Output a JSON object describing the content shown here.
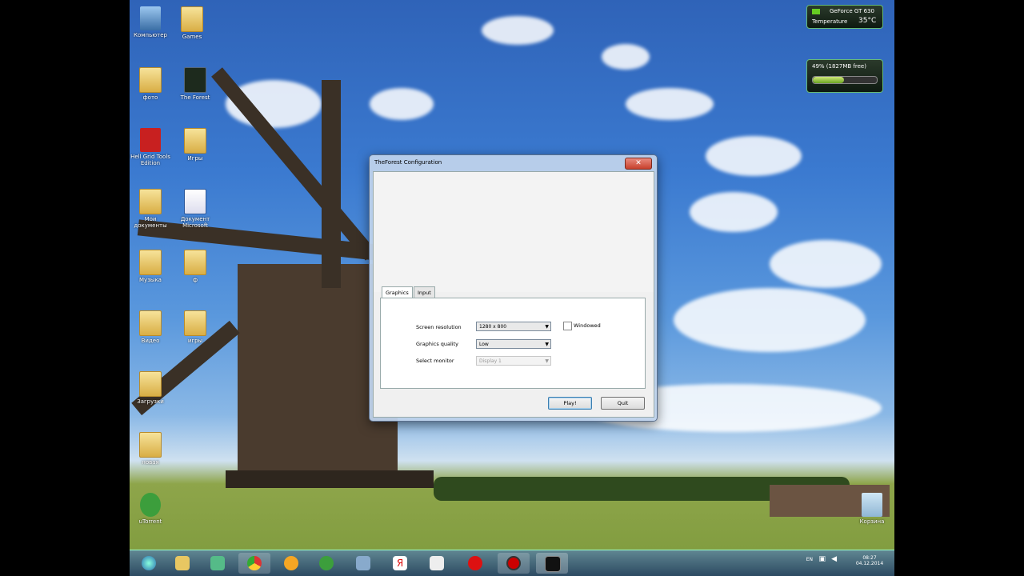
{
  "desktop": {
    "icons": [
      {
        "label": "Компьютер",
        "kind": "computer"
      },
      {
        "label": "Games",
        "kind": "folder"
      },
      {
        "label": "фото",
        "kind": "folder"
      },
      {
        "label": "The Forest",
        "kind": "app"
      },
      {
        "label": "Hell Grid Tools Edition",
        "kind": "app"
      },
      {
        "label": "Игры",
        "kind": "folder"
      },
      {
        "label": "Мои документы",
        "kind": "folder"
      },
      {
        "label": "Документ Microsoft",
        "kind": "word"
      },
      {
        "label": "Музыка",
        "kind": "folder"
      },
      {
        "label": "ф",
        "kind": "folder"
      },
      {
        "label": "Видео",
        "kind": "folder"
      },
      {
        "label": "игры",
        "kind": "folder"
      },
      {
        "label": "Загрузки",
        "kind": "folder"
      },
      {
        "label": "новая",
        "kind": "folder"
      },
      {
        "label": "uTorrent",
        "kind": "app"
      },
      {
        "label": "Корзина",
        "kind": "bin"
      }
    ]
  },
  "gadgets": {
    "gpu": {
      "name": "GeForce GT 630",
      "label": "Temperature",
      "value": "35°C"
    },
    "mem": {
      "text": "49% (1827MB free)",
      "percent": 49
    }
  },
  "dialog": {
    "title": "TheForest Configuration",
    "close_label": "✕",
    "tabs": [
      {
        "label": "Graphics",
        "active": true
      },
      {
        "label": "Input",
        "active": false
      }
    ],
    "fields": {
      "resolution_label": "Screen resolution",
      "resolution_value": "1280 x 800",
      "quality_label": "Graphics quality",
      "quality_value": "Low",
      "monitor_label": "Select monitor",
      "monitor_value": "Display 1",
      "windowed_label": "Windowed"
    },
    "buttons": {
      "play": "Play!",
      "quit": "Quit"
    }
  },
  "taskbar": {
    "apps": [
      "start",
      "explorer",
      "media",
      "chrome",
      "ie-notify",
      "utorrent",
      "folder-media",
      "yandex",
      "notepad",
      "opera",
      "record",
      "the-forest"
    ],
    "tray": {
      "lang": "EN",
      "time": "08:27",
      "date": "04.12.2014"
    }
  },
  "colors": {
    "taskbar": "#2d4a66",
    "accent": "#3c7fb1"
  }
}
